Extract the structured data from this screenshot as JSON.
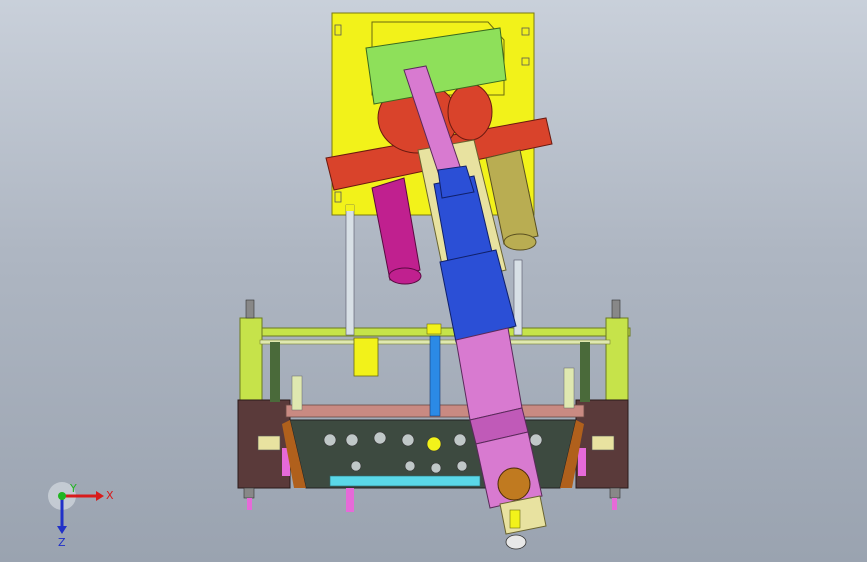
{
  "viewport": {
    "background_top": "#c9d0da",
    "background_bottom": "#9aa3b0"
  },
  "colors": {
    "mount_plate": "#f2f21a",
    "arm_green": "#8ee05a",
    "arm_red": "#d9432b",
    "arm_beige": "#e8e2a0",
    "motor_blue": "#2b4fd6",
    "cylinder_magenta": "#c0208f",
    "cylinder_olive": "#b9ad52",
    "arm_pink": "#d87ad0",
    "frame_green": "#c6e34a",
    "frame_dark": "#5a3a3a"
  },
  "triad": {
    "x_label": "X",
    "y_label": "Y",
    "z_label": "Z"
  }
}
